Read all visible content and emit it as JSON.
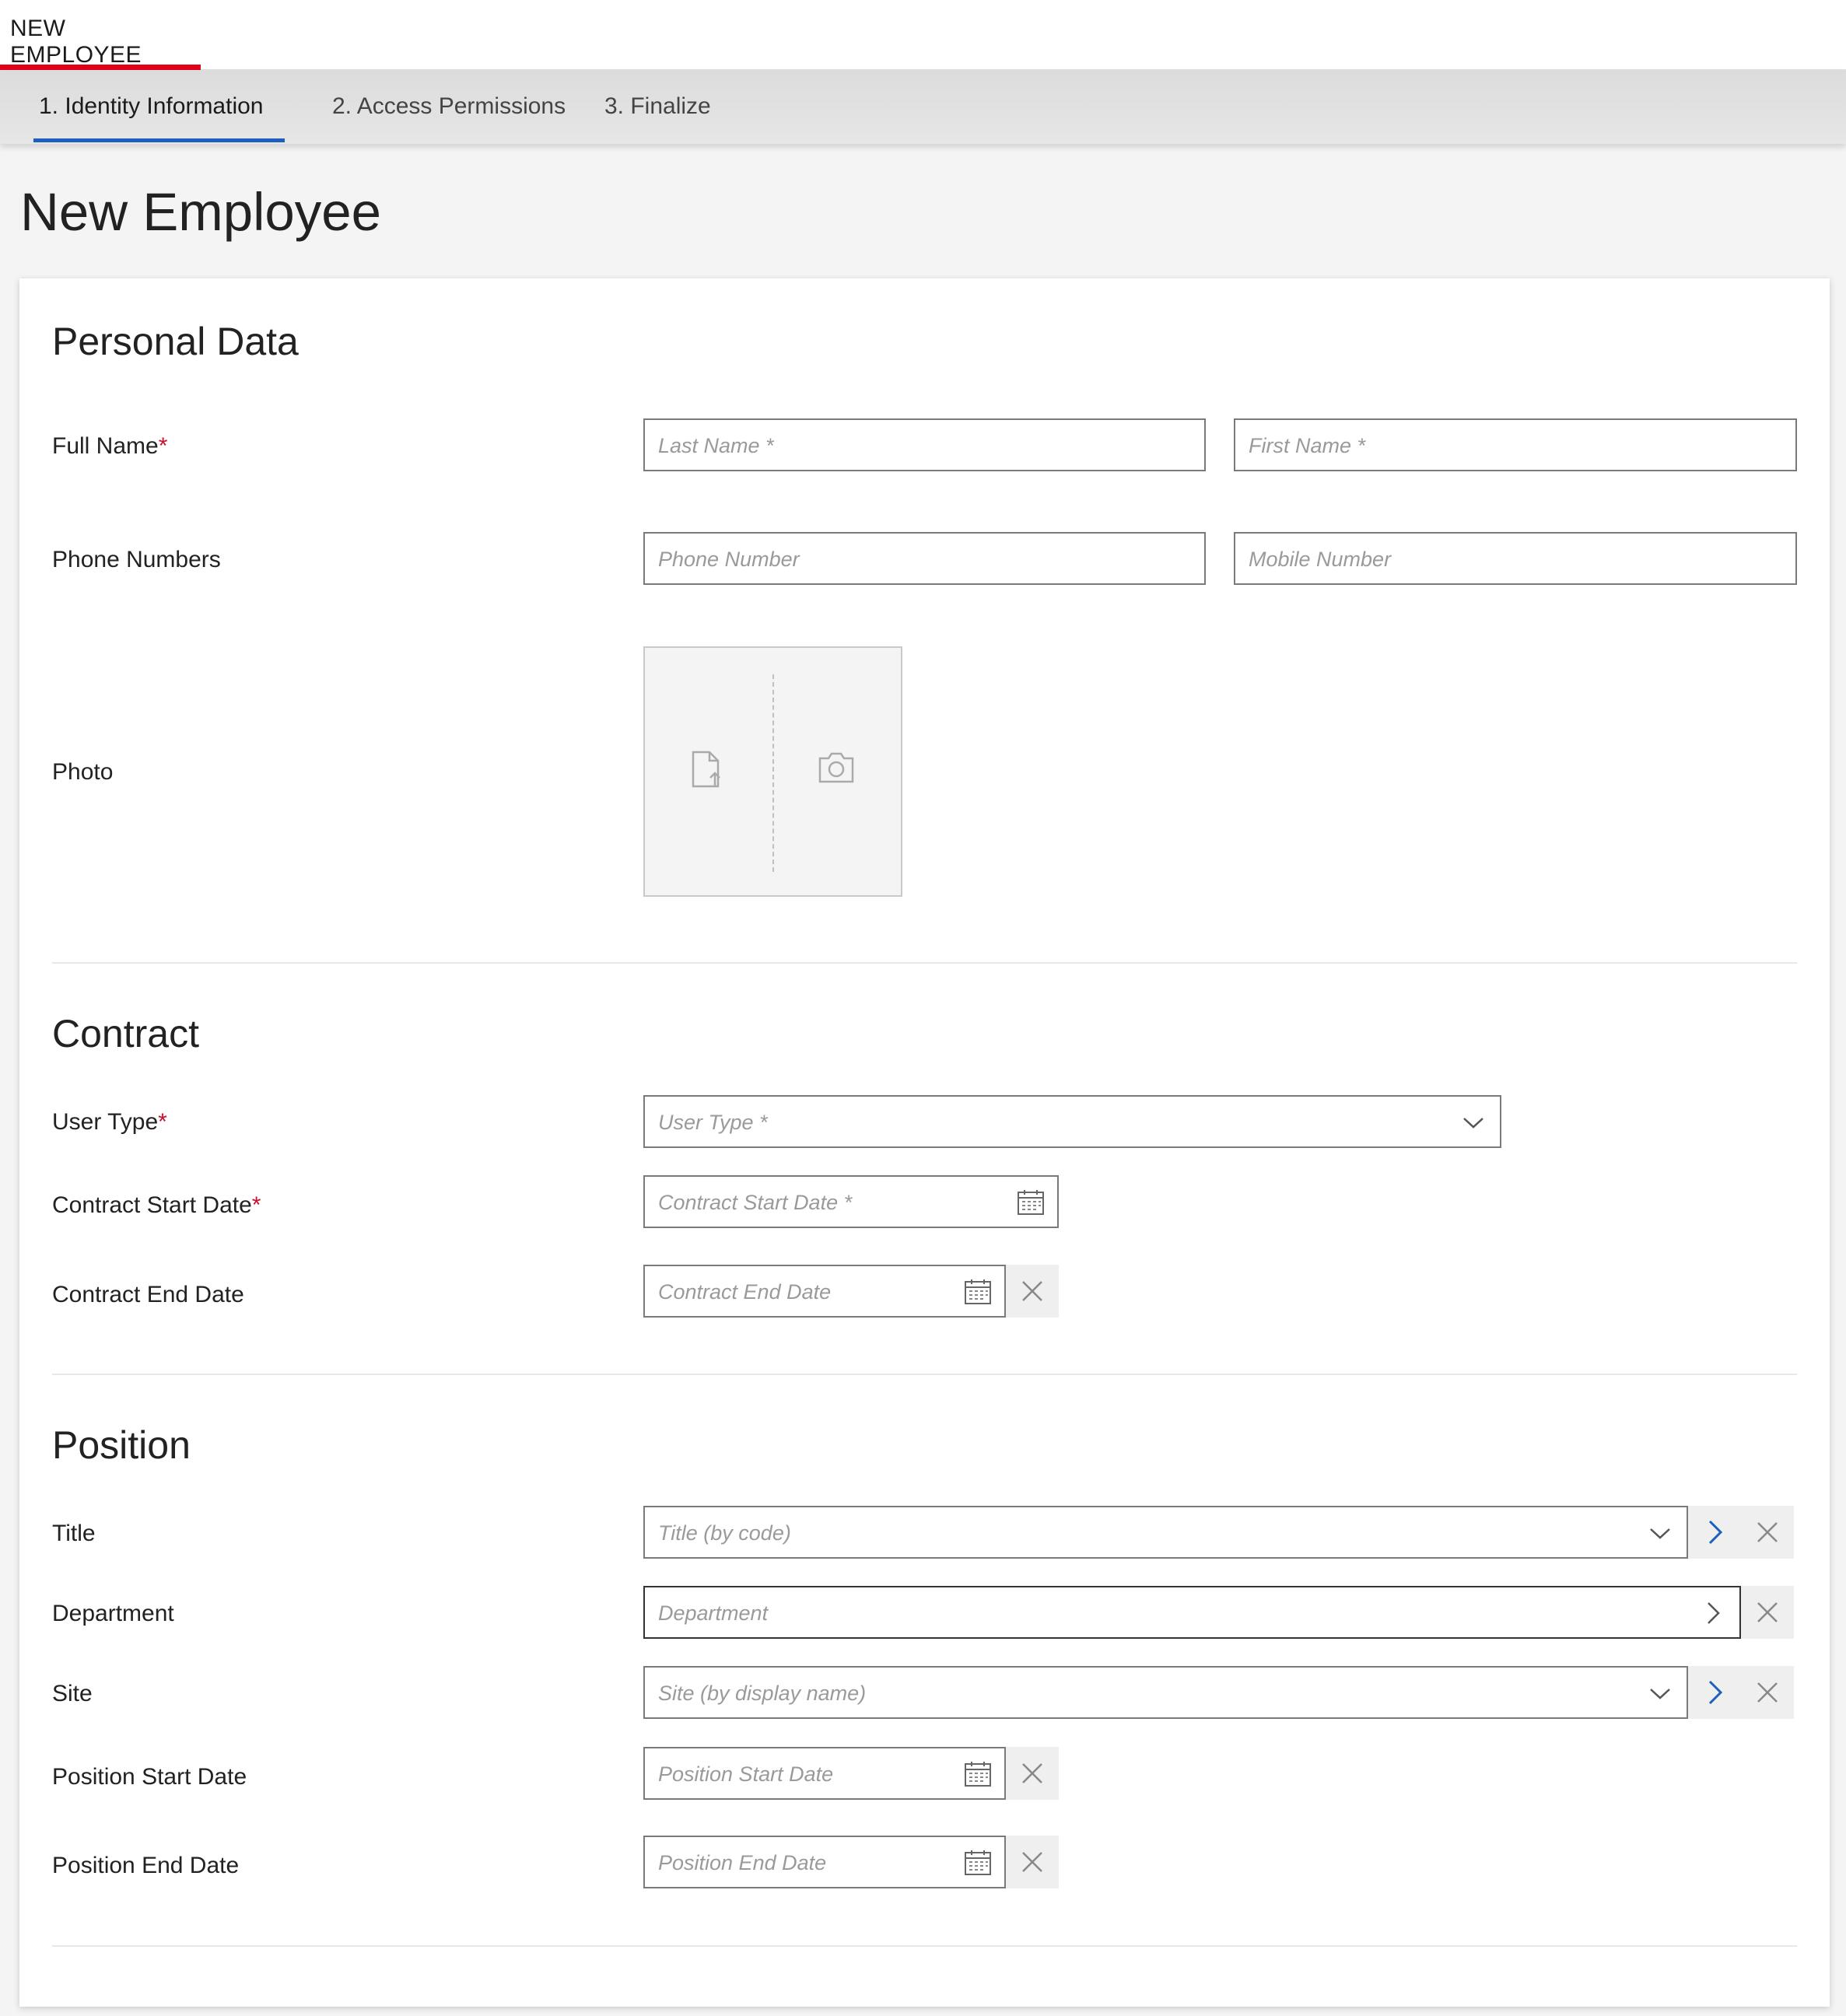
{
  "app_tab": {
    "label": "NEW EMPLOYEE"
  },
  "steps": [
    {
      "label": "1. Identity Information"
    },
    {
      "label": "2. Access Permissions"
    },
    {
      "label": "3. Finalize"
    }
  ],
  "page": {
    "title": "New Employee"
  },
  "personal": {
    "title": "Personal Data",
    "full_name_label": "Full Name",
    "required_mark": "*",
    "last_name_placeholder": "Last Name *",
    "first_name_placeholder": "First Name *",
    "phone_label": "Phone Numbers",
    "phone_placeholder": "Phone Number",
    "mobile_placeholder": "Mobile Number",
    "photo_label": "Photo"
  },
  "contract": {
    "title": "Contract",
    "user_type_label": "User Type",
    "user_type_placeholder": "User Type *",
    "start_label": "Contract Start Date",
    "start_placeholder": "Contract Start Date *",
    "end_label": "Contract End Date",
    "end_placeholder": "Contract End Date"
  },
  "position": {
    "title": "Position",
    "title_label": "Title",
    "title_placeholder": "Title (by code)",
    "department_label": "Department",
    "department_placeholder": "Department",
    "site_label": "Site",
    "site_placeholder": "Site (by display name)",
    "start_label": "Position Start Date",
    "start_placeholder": "Position Start Date",
    "end_label": "Position End Date",
    "end_placeholder": "Position End Date"
  },
  "colors": {
    "accent_red": "#e3001b",
    "accent_blue": "#1c5fbf",
    "required_red": "#c8102e"
  },
  "icons": [
    "document-upload-icon",
    "camera-icon",
    "calendar-icon",
    "chevron-down-icon",
    "chevron-right-icon",
    "close-icon"
  ]
}
